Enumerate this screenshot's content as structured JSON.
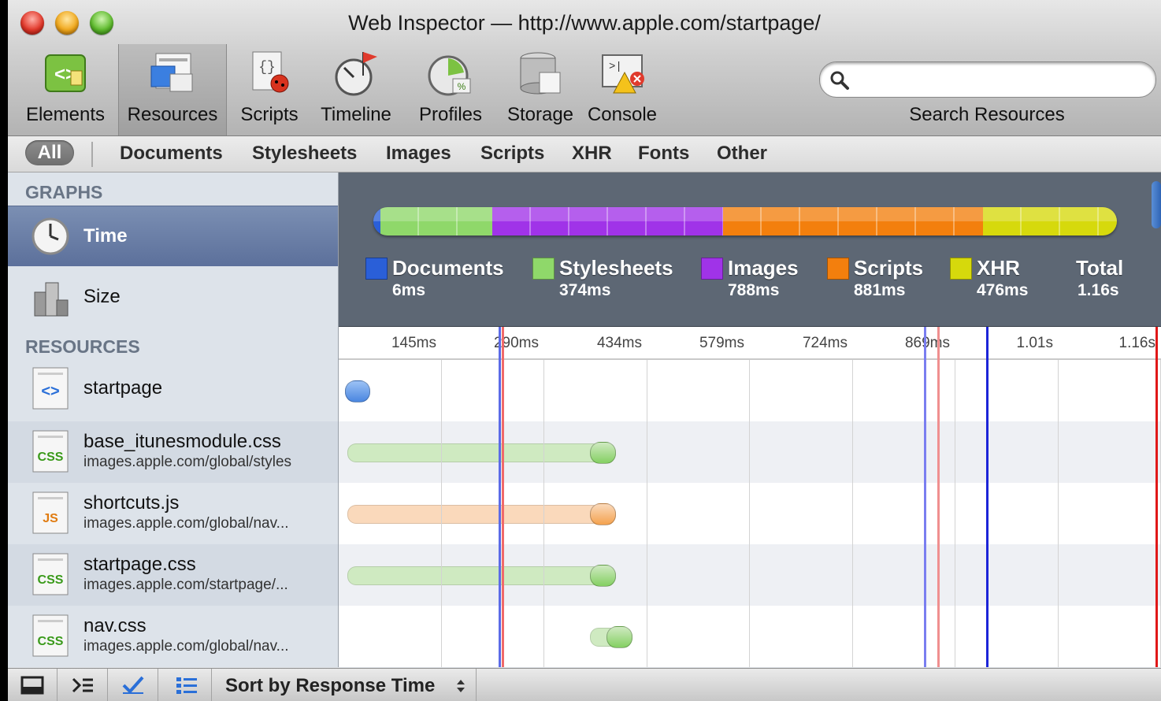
{
  "window": {
    "title": "Web Inspector — http://www.apple.com/startpage/"
  },
  "toolbar": {
    "items": [
      {
        "label": "Elements",
        "icon": "elements-icon"
      },
      {
        "label": "Resources",
        "icon": "resources-icon",
        "selected": true
      },
      {
        "label": "Scripts",
        "icon": "scripts-icon"
      },
      {
        "label": "Timeline",
        "icon": "timeline-icon"
      },
      {
        "label": "Profiles",
        "icon": "profiles-icon"
      },
      {
        "label": "Storage",
        "icon": "storage-icon"
      },
      {
        "label": "Console",
        "icon": "console-icon"
      }
    ],
    "search": {
      "placeholder": "",
      "value": "",
      "label": "Search Resources"
    }
  },
  "filters": {
    "all": "All",
    "items": [
      "Documents",
      "Stylesheets",
      "Images",
      "Scripts",
      "XHR",
      "Fonts",
      "Other"
    ]
  },
  "sidebar": {
    "graphs_heading": "GRAPHS",
    "graphs": [
      {
        "label": "Time",
        "icon": "clock-icon",
        "selected": true
      },
      {
        "label": "Size",
        "icon": "weights-icon"
      }
    ],
    "resources_heading": "RESOURCES",
    "resources": [
      {
        "name": "startpage",
        "subtitle": "",
        "kind": "html"
      },
      {
        "name": "base_itunesmodule.css",
        "subtitle": "images.apple.com/global/styles",
        "kind": "css"
      },
      {
        "name": "shortcuts.js",
        "subtitle": "images.apple.com/global/nav...",
        "kind": "js"
      },
      {
        "name": "startpage.css",
        "subtitle": "images.apple.com/startpage/...",
        "kind": "css"
      },
      {
        "name": "nav.css",
        "subtitle": "images.apple.com/global/nav...",
        "kind": "css"
      }
    ]
  },
  "summary": {
    "legend": [
      {
        "name": "Documents",
        "value": "6ms",
        "color": "#2a5fd8"
      },
      {
        "name": "Stylesheets",
        "value": "374ms",
        "color": "#8fd86a"
      },
      {
        "name": "Images",
        "value": "788ms",
        "color": "#a033e8"
      },
      {
        "name": "Scripts",
        "value": "881ms",
        "color": "#f37f0d"
      },
      {
        "name": "XHR",
        "value": "476ms",
        "color": "#d6d90c"
      }
    ],
    "total": {
      "name": "Total",
      "value": "1.16s"
    },
    "bar_fractions": [
      0.01,
      0.15,
      0.31,
      0.35,
      0.18
    ]
  },
  "timeline": {
    "dividers": [
      "145ms",
      "290ms",
      "434ms",
      "579ms",
      "724ms",
      "869ms",
      "1.01s",
      "1.16s"
    ],
    "rows": [
      {
        "start": 0.002,
        "end": 0.03,
        "latency_end": 0.002,
        "type": "document"
      },
      {
        "start": 0.005,
        "end": 0.33,
        "latency_end": 0.3,
        "type": "css"
      },
      {
        "start": 0.005,
        "end": 0.33,
        "latency_end": 0.3,
        "type": "js"
      },
      {
        "start": 0.005,
        "end": 0.33,
        "latency_end": 0.3,
        "type": "css"
      },
      {
        "start": 0.3,
        "end": 0.35,
        "latency_end": 0.32,
        "type": "css"
      }
    ],
    "markers": [
      {
        "pos": 0.194,
        "color": "#5b6be8"
      },
      {
        "pos": 0.198,
        "color": "#f06a6a"
      },
      {
        "pos": 0.712,
        "color": "#7a7ef0"
      },
      {
        "pos": 0.728,
        "color": "#f08f8f"
      },
      {
        "pos": 0.787,
        "color": "#1c24d8"
      },
      {
        "pos": 0.993,
        "color": "#e01818"
      }
    ]
  },
  "statusbar": {
    "sort_label": "Sort by Response Time"
  }
}
